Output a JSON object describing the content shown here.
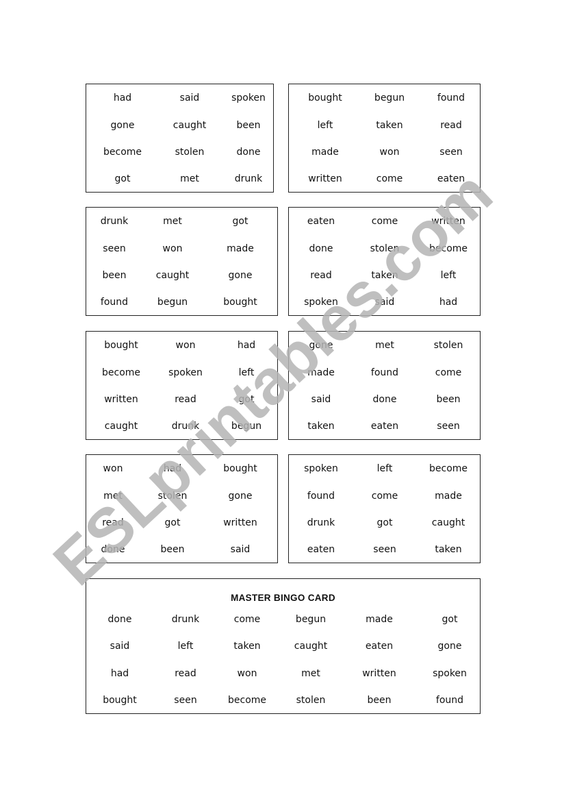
{
  "cards": [
    {
      "words": [
        [
          "had",
          "said",
          "spoken"
        ],
        [
          "gone",
          "caught",
          "been"
        ],
        [
          "become",
          "stolen",
          "done"
        ],
        [
          "got",
          "met",
          "drunk"
        ]
      ]
    },
    {
      "words": [
        [
          "bought",
          "begun",
          "found"
        ],
        [
          "left",
          "taken",
          "read"
        ],
        [
          "made",
          "won",
          "seen"
        ],
        [
          "written",
          "come",
          "eaten"
        ]
      ]
    },
    {
      "words": [
        [
          "drunk",
          "met",
          "got"
        ],
        [
          "seen",
          "won",
          "made"
        ],
        [
          "been",
          "caught",
          "gone"
        ],
        [
          "found",
          "begun",
          "bought"
        ]
      ]
    },
    {
      "words": [
        [
          "eaten",
          "come",
          "written"
        ],
        [
          "done",
          "stolen",
          "become"
        ],
        [
          "read",
          "taken",
          "left"
        ],
        [
          "spoken",
          "said",
          "had"
        ]
      ]
    },
    {
      "words": [
        [
          "bought",
          "won",
          "had"
        ],
        [
          "become",
          "spoken",
          "left"
        ],
        [
          "written",
          "read",
          "got"
        ],
        [
          "caught",
          "drunk",
          "begun"
        ]
      ]
    },
    {
      "words": [
        [
          "gone",
          "met",
          "stolen"
        ],
        [
          "made",
          "found",
          "come"
        ],
        [
          "said",
          "done",
          "been"
        ],
        [
          "taken",
          "eaten",
          "seen"
        ]
      ]
    },
    {
      "words": [
        [
          "won",
          "had",
          "bought"
        ],
        [
          "met",
          "stolen",
          "gone"
        ],
        [
          "read",
          "got",
          "written"
        ],
        [
          "done",
          "been",
          "said"
        ]
      ]
    },
    {
      "words": [
        [
          "spoken",
          "left",
          "become"
        ],
        [
          "found",
          "come",
          "made"
        ],
        [
          "drunk",
          "got",
          "caught"
        ],
        [
          "eaten",
          "seen",
          "taken"
        ]
      ]
    }
  ],
  "master": {
    "title": "MASTER BINGO CARD",
    "words": [
      [
        "done",
        "drunk",
        "come",
        "begun",
        "made",
        "got"
      ],
      [
        "said",
        "left",
        "taken",
        "caught",
        "eaten",
        "gone"
      ],
      [
        "had",
        "read",
        "won",
        "met",
        "written",
        "spoken"
      ],
      [
        "bought",
        "seen",
        "become",
        "stolen",
        "been",
        "found"
      ]
    ]
  },
  "watermark": {
    "text": "ESLprintables.com",
    "color": "#b4b4b4"
  }
}
